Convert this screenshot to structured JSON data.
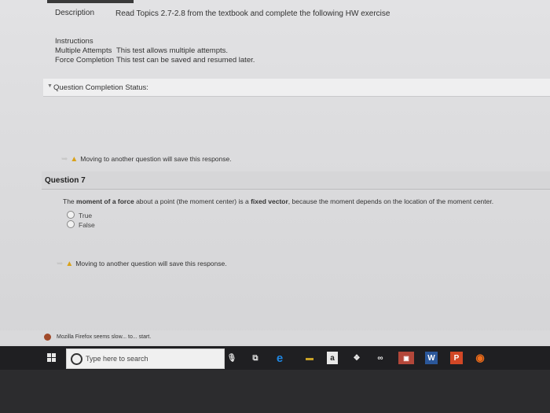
{
  "assignment": {
    "description_label": "Description",
    "description_text": "Read Topics 2.7-2.8 from the textbook and complete the following HW exercise",
    "instructions_label": "Instructions",
    "multiple_attempts_label": "Multiple Attempts",
    "multiple_attempts_text": "This test allows multiple attempts.",
    "force_completion_label": "Force Completion",
    "force_completion_text": "This test can be saved and resumed later."
  },
  "question_completion_status": {
    "label": "Question Completion Status:"
  },
  "warnings": {
    "save_response": "Moving to another question will save this response."
  },
  "question": {
    "title": "Question 7",
    "text_pre": "The ",
    "text_term1": "moment of a force",
    "text_mid": " about a point (the moment center) is a ",
    "text_term2": "fixed vector",
    "text_post": ", because the moment depends on the location of the moment center.",
    "options": [
      "True",
      "False"
    ]
  },
  "browser_notification": {
    "text": "Mozilla Firefox seems slow... to... start."
  },
  "taskbar": {
    "search_placeholder": "Type here to search",
    "app_a_label": "a",
    "app_word_label": "W",
    "app_ppt_label": "P"
  },
  "colors": {
    "warning": "#d9a21a",
    "taskbar": "#1f1f22",
    "edge": "#1e88e5"
  }
}
